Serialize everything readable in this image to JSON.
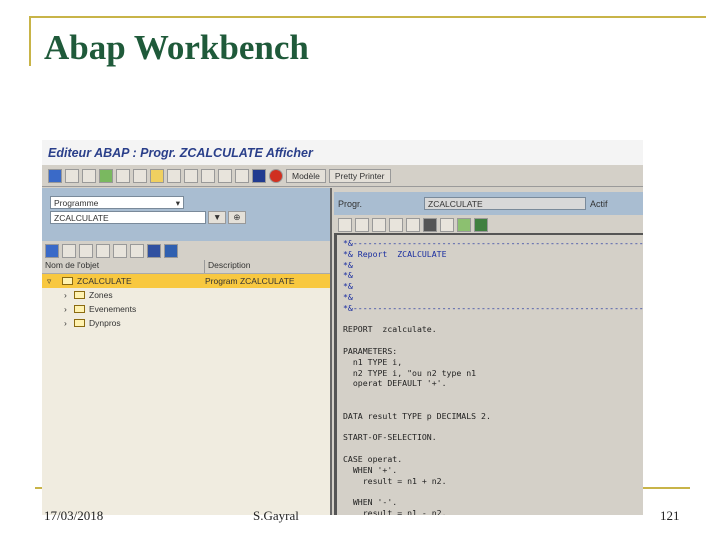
{
  "slide": {
    "title": "Abap Workbench",
    "date": "17/03/2018",
    "author": "S.Gayral",
    "page": "121"
  },
  "window": {
    "title": "Editeur ABAP : Progr. ZCALCULATE Afficher"
  },
  "toolbar": {
    "modele": "Modèle",
    "pretty_printer": "Pretty Printer"
  },
  "left": {
    "object_type": "Programme",
    "object_name": "ZCALCULATE",
    "columns": [
      "Nom de l'objet",
      "Description"
    ],
    "tree": [
      {
        "name": "ZCALCULATE",
        "desc": "Program ZCALCULATE"
      },
      {
        "name": "Zones"
      },
      {
        "name": "Evenements"
      },
      {
        "name": "Dynpros"
      }
    ]
  },
  "right": {
    "label": "Progr.",
    "program": "ZCALCULATE",
    "status": "Actif"
  },
  "code": [
    "*&---------------------------------------------------------------------",
    "*& Report  ZCALCULATE",
    "*&",
    "*&",
    "*&",
    "*&",
    "*&---------------------------------------------------------------------",
    "",
    "REPORT  zcalculate.",
    "",
    "PARAMETERS:",
    "  n1 TYPE i,",
    "  n2 TYPE i, \"ou n2 type n1",
    "  operat DEFAULT '+'.",
    "",
    "",
    "DATA result TYPE p DECIMALS 2.",
    "",
    "START-OF-SELECTION.",
    "",
    "CASE operat.",
    "  WHEN '+'.",
    "    result = n1 + n2.",
    "",
    "  WHEN '-'.",
    "    result = n1 - n2."
  ]
}
